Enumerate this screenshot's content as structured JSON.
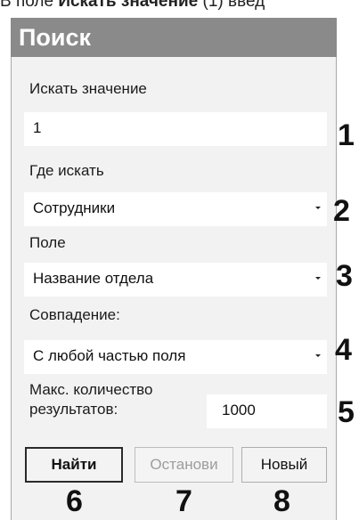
{
  "doc_text": {
    "prefix": "В поле ",
    "bold": "Искать значение",
    "suffix": " (1) введ"
  },
  "panel": {
    "title": "Поиск"
  },
  "search_value": {
    "label": "Искать значение",
    "value": "1",
    "marker": "1"
  },
  "where": {
    "label": "Где искать",
    "selected": "Сотрудники",
    "marker": "2"
  },
  "field": {
    "label": "Поле",
    "selected": "Название отдела",
    "marker": "3"
  },
  "match": {
    "label": "Совпадение:",
    "selected": "С любой частью поля",
    "marker": "4"
  },
  "max_results": {
    "label_line1": "Макс. количество",
    "label_line2": "результатов:",
    "value": "1000",
    "marker": "5"
  },
  "buttons": {
    "find": {
      "label": "Найти",
      "marker": "6"
    },
    "stop": {
      "label": "Останови",
      "marker": "7",
      "disabled": true
    },
    "new": {
      "label": "Новый",
      "marker": "8"
    }
  },
  "icons": {
    "dropdown": "chevron-down-icon"
  }
}
